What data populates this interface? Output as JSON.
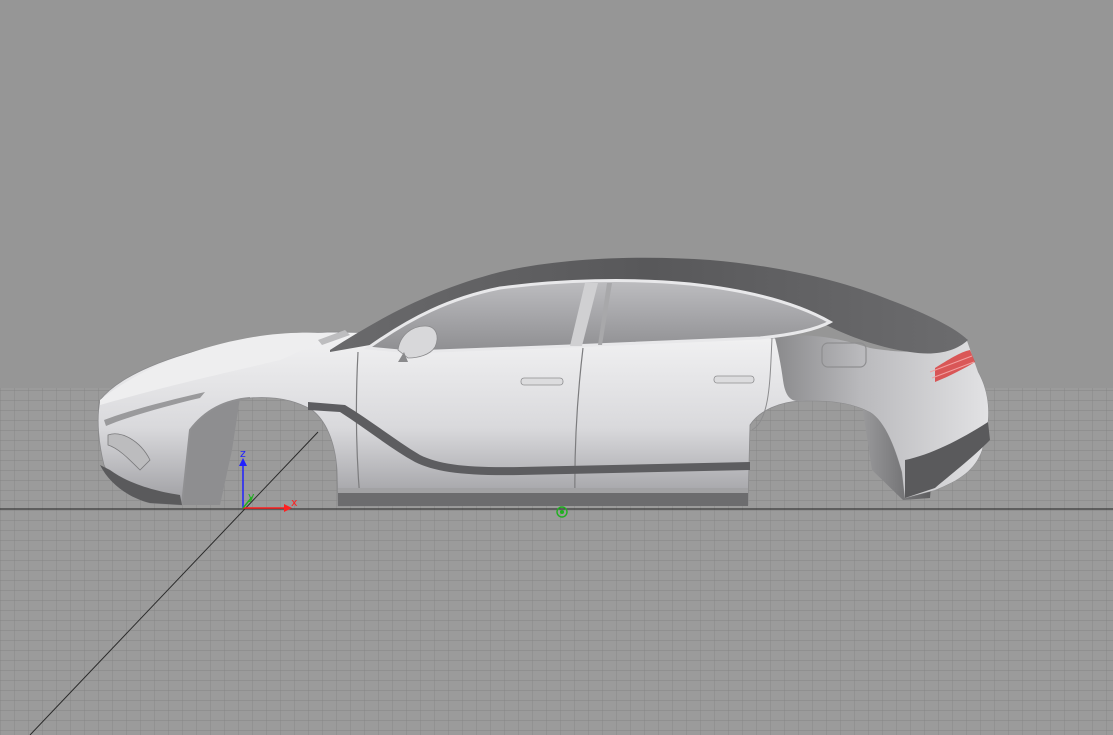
{
  "viewport": {
    "background_color": "#969696",
    "grid_color": "#7f7f7f",
    "grid_fill": "#9c9c9c",
    "horizon_line_color": "#3a3a3a"
  },
  "axes": {
    "x": {
      "label": "x",
      "color": "#ff2020"
    },
    "y": {
      "label": "y",
      "color": "#20b020"
    },
    "z": {
      "label": "z",
      "color": "#2020ff"
    }
  },
  "model": {
    "icon": "car-body-3d-model",
    "body_light": "#e6e6e8",
    "body_mid": "#c7c7ca",
    "body_dark": "#707072",
    "roof": "#5f5f61",
    "taillight": "#d94040"
  },
  "pivot": {
    "icon": "pivot-marker-icon",
    "color": "#20b020"
  }
}
